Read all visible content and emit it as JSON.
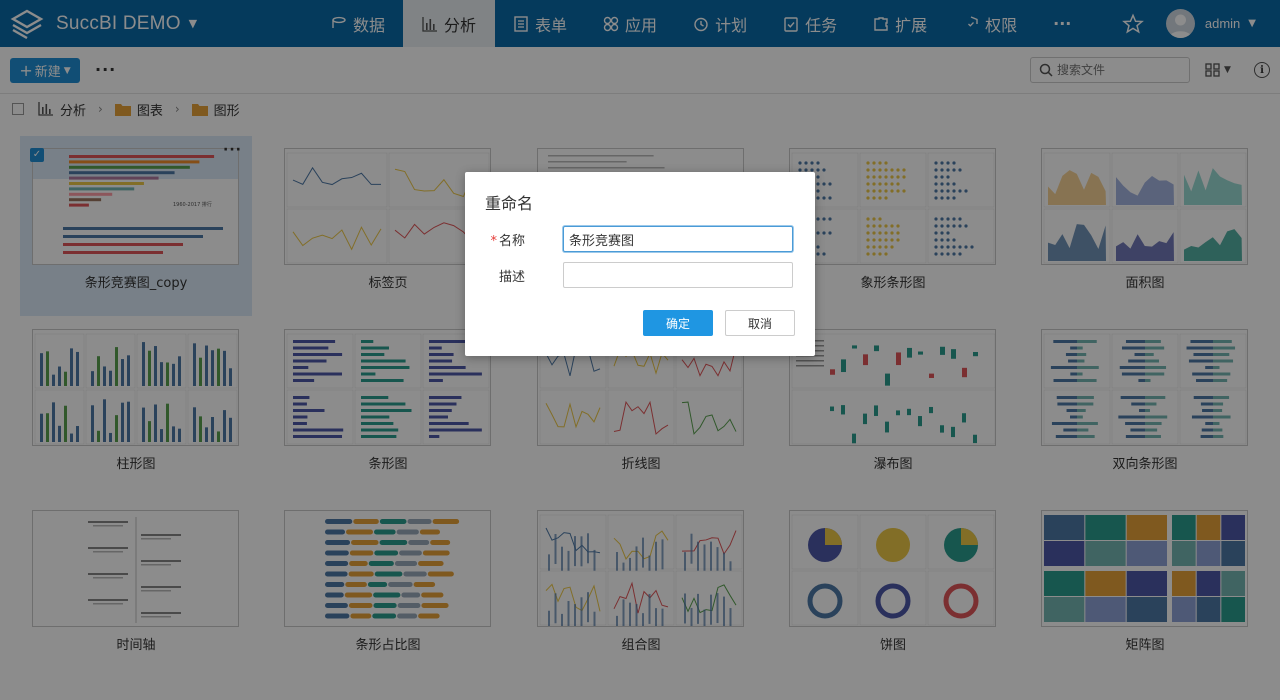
{
  "app": {
    "brand": "SuccBI DEMO",
    "user": "admin"
  },
  "nav": {
    "items": [
      {
        "label": "数据",
        "icon": "database-icon"
      },
      {
        "label": "分析",
        "icon": "bar-chart-icon",
        "active": true
      },
      {
        "label": "表单",
        "icon": "form-icon"
      },
      {
        "label": "应用",
        "icon": "app-grid-icon"
      },
      {
        "label": "计划",
        "icon": "clock-icon"
      },
      {
        "label": "任务",
        "icon": "task-check-icon"
      },
      {
        "label": "扩展",
        "icon": "extension-icon"
      },
      {
        "label": "权限",
        "icon": "shield-icon"
      }
    ],
    "more": "···"
  },
  "toolbar": {
    "new_label": "新建",
    "more": "···",
    "search_placeholder": "搜索文件"
  },
  "breadcrumb": [
    "分析",
    "图表",
    "图形"
  ],
  "cards": [
    {
      "label": "条形竞赛图_copy",
      "selected": true,
      "kind": "race"
    },
    {
      "label": "标签页",
      "kind": "lines"
    },
    {
      "label": "",
      "kind": "blank"
    },
    {
      "label": "象形条形图",
      "kind": "pictorial"
    },
    {
      "label": "面积图",
      "kind": "area"
    },
    {
      "label": "柱形图",
      "kind": "columns"
    },
    {
      "label": "条形图",
      "kind": "bars"
    },
    {
      "label": "折线图",
      "kind": "lines2"
    },
    {
      "label": "瀑布图",
      "kind": "waterfall"
    },
    {
      "label": "双向条形图",
      "kind": "bidir"
    },
    {
      "label": "时间轴",
      "kind": "timeline"
    },
    {
      "label": "条形占比图",
      "kind": "ratio"
    },
    {
      "label": "组合图",
      "kind": "combo"
    },
    {
      "label": "饼图",
      "kind": "pie"
    },
    {
      "label": "矩阵图",
      "kind": "treemap"
    }
  ],
  "dialog": {
    "title": "重命名",
    "name_label": "名称",
    "name_value": "条形竞赛图",
    "desc_label": "描述",
    "desc_value": "",
    "ok": "确定",
    "cancel": "取消"
  },
  "thumb_text": {
    "race_year": "1960"
  },
  "colors": {
    "nav_bg": "#0a6aa8",
    "primary": "#1f8fd6",
    "folder": "#e8a33a"
  }
}
